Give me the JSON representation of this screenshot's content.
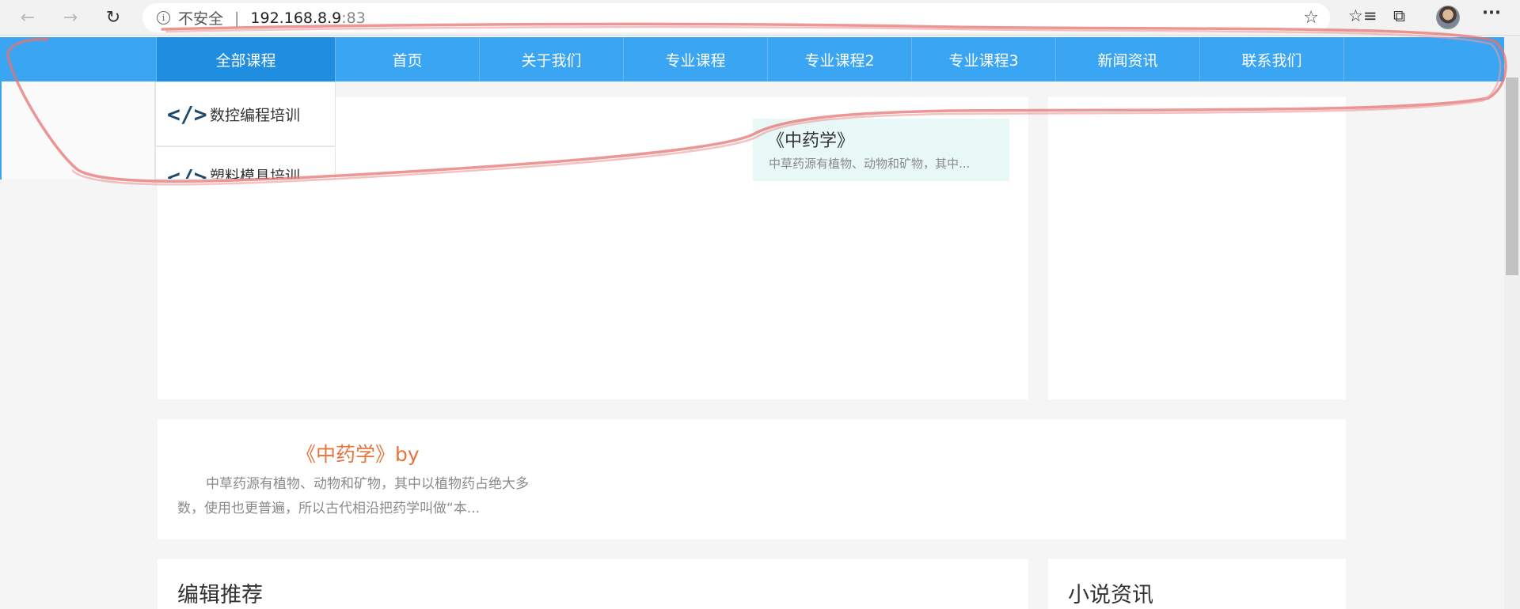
{
  "browser": {
    "security_label": "不安全",
    "separator": "|",
    "url_host": "192.168.8.9",
    "url_port": ":83",
    "icons": {
      "back": "back-arrow-icon",
      "forward": "forward-arrow-icon",
      "refresh": "refresh-icon",
      "info": "info-icon",
      "star": "star-icon",
      "favorites": "favorites-icon",
      "collections": "collections-icon",
      "menu": "more-menu-icon"
    },
    "info_glyph": "i",
    "star_glyph": "☆",
    "favorites_glyph": "☆≡",
    "collections_glyph": "⧉",
    "menu_glyph": "···"
  },
  "nav": {
    "items": [
      {
        "label": "全部课程"
      },
      {
        "label": "首页"
      },
      {
        "label": "关于我们"
      },
      {
        "label": "专业课程"
      },
      {
        "label": "专业课程2"
      },
      {
        "label": "专业课程3"
      },
      {
        "label": "新闻资讯"
      },
      {
        "label": "联系我们"
      }
    ],
    "accent": "#3aa5f3",
    "active_bg": "#1f8de0"
  },
  "dropdown": {
    "items": [
      {
        "label": "数控编程培训"
      },
      {
        "label": "塑料模具培训"
      }
    ],
    "icon_glyph": "</>"
  },
  "slider": {
    "caption_title": "《中药学》",
    "caption_desc": "中草药源有植物、动物和矿物，其中..."
  },
  "feature": {
    "title": "《中药学》by",
    "description": "中草药源有植物、动物和矿物，其中以植物药占绝大多数，使用也更普遍，所以古代相沿把药学叫做“本..."
  },
  "sections": {
    "editor_pick": "编辑推荐",
    "novel_news": "小说资讯"
  },
  "colors": {
    "feature_title": "#e8743b",
    "annotation": "#e57373"
  }
}
